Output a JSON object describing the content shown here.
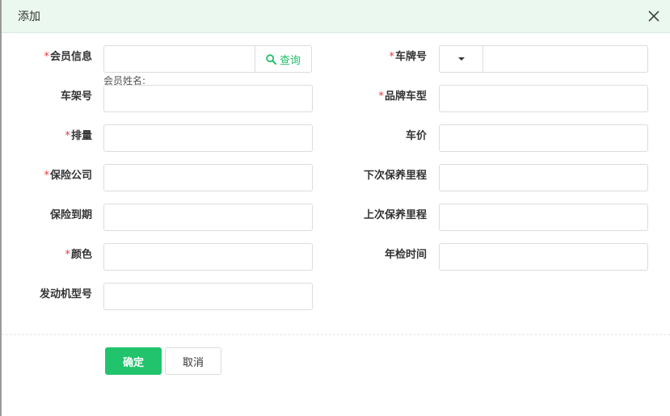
{
  "dialog": {
    "title": "添加"
  },
  "form": {
    "member_info": {
      "label": "会员信息",
      "required": "*",
      "value": "",
      "query_label": "查询",
      "name_label": "会员姓名:"
    },
    "plate": {
      "label": "车牌号",
      "required": "*",
      "prefix_value": "",
      "value": ""
    },
    "frame_no": {
      "label": "车架号",
      "value": ""
    },
    "brand_model": {
      "label": "品牌车型",
      "required": "*",
      "value": ""
    },
    "displacement": {
      "label": "排量",
      "required": "*",
      "value": ""
    },
    "price": {
      "label": "车价",
      "value": ""
    },
    "insurer": {
      "label": "保险公司",
      "required": "*",
      "value": ""
    },
    "next_maint": {
      "label": "下次保养里程",
      "value": ""
    },
    "insurance_expiry": {
      "label": "保险到期",
      "value": ""
    },
    "last_maint": {
      "label": "上次保养里程",
      "value": ""
    },
    "color": {
      "label": "颜色",
      "required": "*",
      "value": ""
    },
    "inspection_time": {
      "label": "年检时间",
      "value": ""
    },
    "engine_model": {
      "label": "发动机型号",
      "value": ""
    }
  },
  "actions": {
    "ok_label": "确定",
    "cancel_label": "取消"
  },
  "icons": {
    "close": "close-icon",
    "search": "search-icon",
    "caret": "caret-down-icon"
  },
  "colors": {
    "accent": "#21c46c",
    "required": "#e4393c",
    "header_bg": "#eaf8ef"
  }
}
